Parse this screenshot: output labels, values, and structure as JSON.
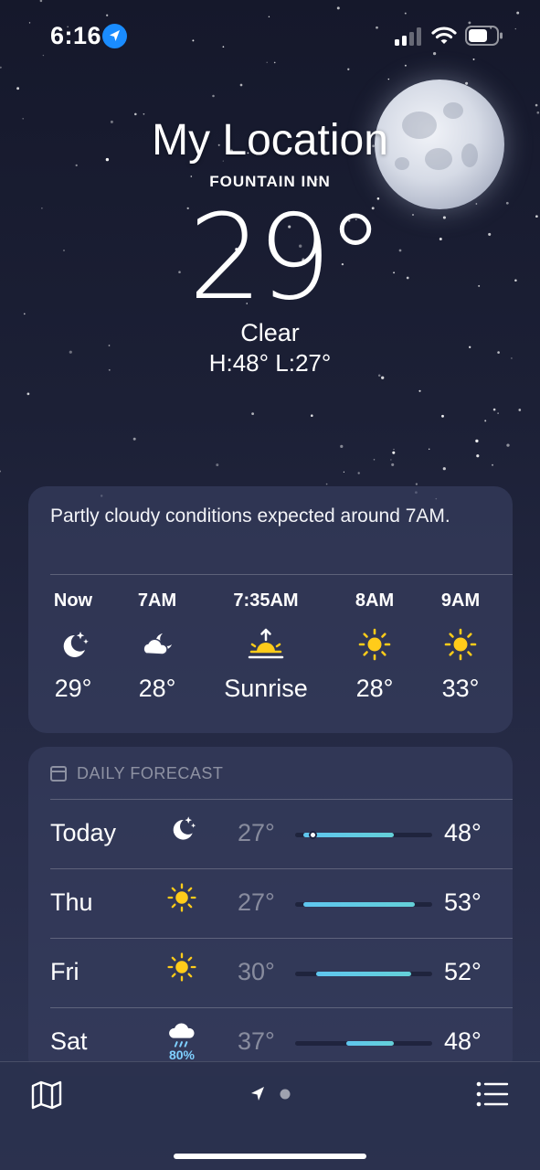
{
  "status_bar": {
    "time": "6:16",
    "icons": [
      "location-arrow-icon",
      "cellular-signal-icon",
      "wifi-icon",
      "battery-icon"
    ]
  },
  "header": {
    "title": "My Location",
    "city": "FOUNTAIN INN",
    "temperature": "29°",
    "condition": "Clear",
    "high_low": "H:48°  L:27°"
  },
  "hourly": {
    "summary": "Partly cloudy conditions expected around 7AM.",
    "items": [
      {
        "label": "Now",
        "icon": "moon-stars-icon",
        "value": "29°"
      },
      {
        "label": "7AM",
        "icon": "cloud-moon-icon",
        "value": "28°"
      },
      {
        "label": "7:35AM",
        "icon": "sunrise-icon",
        "value": "Sunrise"
      },
      {
        "label": "8AM",
        "icon": "sun-icon",
        "value": "28°"
      },
      {
        "label": "9AM",
        "icon": "sun-icon",
        "value": "33°"
      }
    ]
  },
  "daily": {
    "header": "DAILY FORECAST",
    "scale_min": 25,
    "scale_max": 57,
    "days": [
      {
        "name": "Today",
        "icon": "moon-stars-icon",
        "precip": "",
        "low": "27°",
        "high": "48°",
        "low_value": 27,
        "high_value": 48,
        "current_value": 29
      },
      {
        "name": "Thu",
        "icon": "sun-icon",
        "precip": "",
        "low": "27°",
        "high": "53°",
        "low_value": 27,
        "high_value": 53
      },
      {
        "name": "Fri",
        "icon": "sun-icon",
        "precip": "",
        "low": "30°",
        "high": "52°",
        "low_value": 30,
        "high_value": 52
      },
      {
        "name": "Sat",
        "icon": "cloud-rain-icon",
        "precip": "80%",
        "low": "37°",
        "high": "48°",
        "low_value": 37,
        "high_value": 48
      }
    ]
  },
  "toolbar": {
    "icons": [
      "map-icon",
      "location-arrow-icon",
      "page-dot-icon",
      "list-icon"
    ]
  },
  "colors": {
    "sun": "#ffcc1a",
    "accent_blue": "#1a8cff",
    "range_fill": "#5fc6ef",
    "precip": "#7fd0ff"
  }
}
